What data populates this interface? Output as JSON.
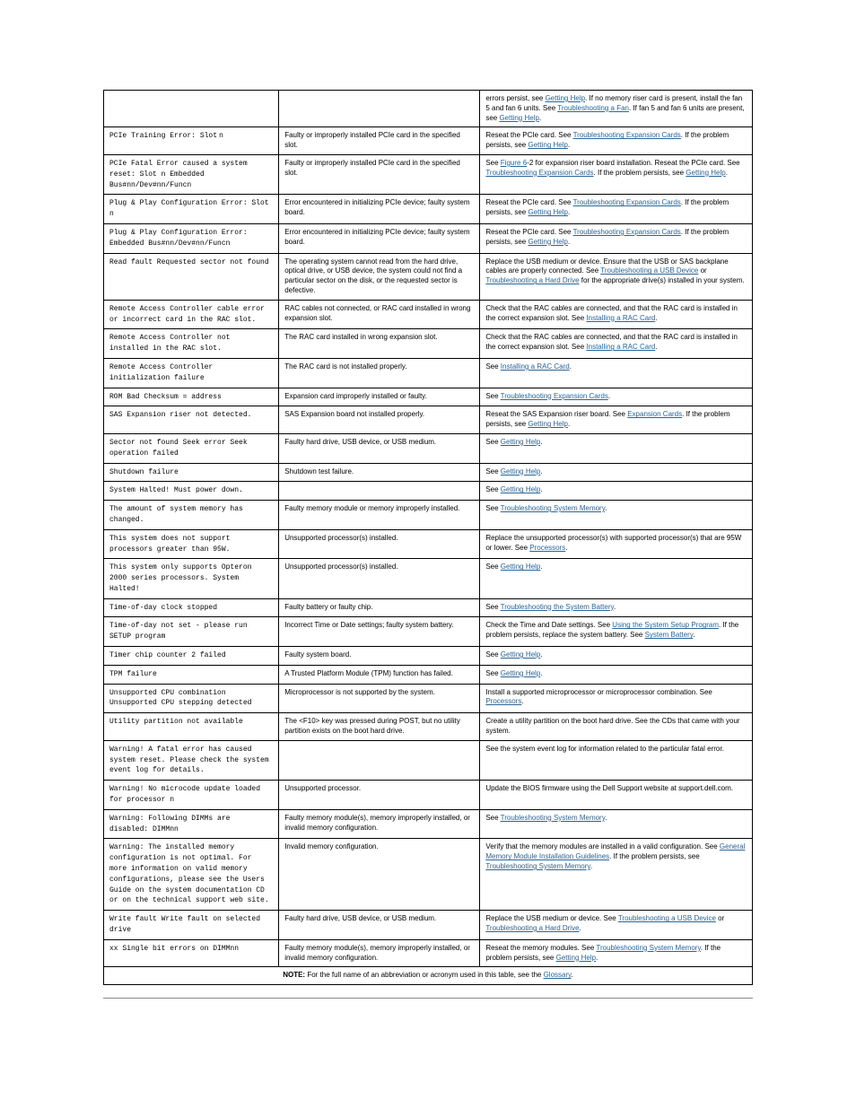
{
  "rows": [
    {
      "msg": "",
      "cause": "",
      "action_parts": [
        {
          "t": "plain",
          "v": "errors persist, see "
        },
        {
          "t": "link",
          "v": "Getting Help"
        },
        {
          "t": "plain",
          "v": ". If no memory riser card is present, install the fan 5 and fan 6 units. See "
        },
        {
          "t": "link",
          "v": "Troubleshooting a Fan"
        },
        {
          "t": "plain",
          "v": ". If fan 5 and fan 6 units are present, see "
        },
        {
          "t": "link",
          "v": "Getting Help"
        },
        {
          "t": "plain",
          "v": "."
        }
      ]
    },
    {
      "msg_mono": "PCIe Training Error: Slot",
      "msg_sans": " n",
      "cause": "Faulty or improperly installed PCIe card in the specified slot.",
      "action_parts": [
        {
          "t": "plain",
          "v": "Reseat the PCIe card. See "
        },
        {
          "t": "link",
          "v": "Troubleshooting Expansion Cards"
        },
        {
          "t": "plain",
          "v": ". If the problem persists, see "
        },
        {
          "t": "link",
          "v": "Getting Help"
        },
        {
          "t": "plain",
          "v": "."
        }
      ]
    },
    {
      "msg": "PCIe Fatal Error caused a system reset: Slot n\nEmbedded Bus#nn/Dev#nn/Funcn",
      "cause": "Faulty or improperly installed PCIe card in the specified slot.",
      "action_parts": [
        {
          "t": "plain",
          "v": "See "
        },
        {
          "t": "link",
          "v": "Figure 6"
        },
        {
          "t": "plain",
          "v": "-2 for expansion riser board installation. Reseat the PCIe card. See "
        },
        {
          "t": "link",
          "v": "Troubleshooting Expansion Cards"
        },
        {
          "t": "plain",
          "v": ". If the problem persists, see "
        },
        {
          "t": "link",
          "v": "Getting Help"
        },
        {
          "t": "plain",
          "v": "."
        }
      ]
    },
    {
      "msg": "Plug & Play Configuration Error: Slot n",
      "cause": "Error encountered in initializing PCIe device; faulty system board.",
      "action_parts": [
        {
          "t": "plain",
          "v": "Reseat the PCIe card. See "
        },
        {
          "t": "link",
          "v": "Troubleshooting Expansion Cards"
        },
        {
          "t": "plain",
          "v": ". If the problem persists, see "
        },
        {
          "t": "link",
          "v": "Getting Help"
        },
        {
          "t": "plain",
          "v": "."
        }
      ]
    },
    {
      "msg": "Plug & Play Configuration Error: Embedded Bus#nn/Dev#nn/Funcn",
      "cause": "Error encountered in initializing PCIe device; faulty system board.",
      "action_parts": [
        {
          "t": "plain",
          "v": "Reseat the PCIe card. See "
        },
        {
          "t": "link",
          "v": "Troubleshooting Expansion Cards"
        },
        {
          "t": "plain",
          "v": ". If the problem persists, see "
        },
        {
          "t": "link",
          "v": "Getting Help"
        },
        {
          "t": "plain",
          "v": "."
        }
      ]
    },
    {
      "msg": "Read fault Requested sector not found",
      "cause": "The operating system cannot read from the hard drive, optical drive, or USB device, the system could not find a particular sector on the disk, or the requested sector is defective.",
      "action_parts": [
        {
          "t": "plain",
          "v": "Replace the USB medium or device. Ensure that the USB or SAS backplane cables are properly connected. See "
        },
        {
          "t": "link",
          "v": "Troubleshooting a USB Device"
        },
        {
          "t": "plain",
          "v": " or "
        },
        {
          "t": "link",
          "v": "Troubleshooting a Hard Drive"
        },
        {
          "t": "plain",
          "v": " for the appropriate drive(s) installed in your system."
        }
      ]
    },
    {
      "msg": "Remote Access Controller cable error or incorrect card in the RAC slot.",
      "cause": "RAC cables not connected, or RAC card installed in wrong expansion slot.",
      "action_parts": [
        {
          "t": "plain",
          "v": "Check that the RAC cables are connected, and that the RAC card is installed in the correct expansion slot. See "
        },
        {
          "t": "link",
          "v": "Installing a RAC Card"
        },
        {
          "t": "plain",
          "v": "."
        }
      ]
    },
    {
      "msg": "Remote Access Controller not installed in the RAC slot.",
      "cause": "The RAC card installed in wrong expansion slot.",
      "action_parts": [
        {
          "t": "plain",
          "v": "Check that the RAC cables are connected, and that the RAC card is installed in the correct expansion slot. See "
        },
        {
          "t": "link",
          "v": "Installing a RAC Card"
        },
        {
          "t": "plain",
          "v": "."
        }
      ]
    },
    {
      "msg": "Remote Access Controller initialization failure",
      "cause": "The RAC card is not installed properly.",
      "action_parts": [
        {
          "t": "plain",
          "v": "See "
        },
        {
          "t": "link",
          "v": "Installing a RAC Card"
        },
        {
          "t": "plain",
          "v": "."
        }
      ]
    },
    {
      "msg": "ROM Bad Checksum = address",
      "cause": "Expansion card improperly installed or faulty.",
      "action_parts": [
        {
          "t": "plain",
          "v": "See "
        },
        {
          "t": "link",
          "v": "Troubleshooting Expansion Cards"
        },
        {
          "t": "plain",
          "v": "."
        }
      ]
    },
    {
      "msg": "SAS Expansion riser not detected.",
      "cause": "SAS Expansion board not installed properly.",
      "action_parts": [
        {
          "t": "plain",
          "v": "Reseat the SAS Expansion riser board. See "
        },
        {
          "t": "link",
          "v": "Expansion Cards"
        },
        {
          "t": "plain",
          "v": ". If the problem persists, see "
        },
        {
          "t": "link",
          "v": "Getting Help"
        },
        {
          "t": "plain",
          "v": "."
        }
      ]
    },
    {
      "msg": "Sector not found Seek error Seek operation failed",
      "cause": "Faulty hard drive, USB device, or USB medium.",
      "action_parts": [
        {
          "t": "plain",
          "v": "See "
        },
        {
          "t": "link",
          "v": "Getting Help"
        },
        {
          "t": "plain",
          "v": "."
        }
      ]
    },
    {
      "msg": "Shutdown failure",
      "cause": "Shutdown test failure.",
      "action_parts": [
        {
          "t": "plain",
          "v": "See "
        },
        {
          "t": "link",
          "v": "Getting Help"
        },
        {
          "t": "plain",
          "v": "."
        }
      ]
    },
    {
      "msg": "System Halted! Must power down.",
      "cause": "",
      "action_parts": [
        {
          "t": "plain",
          "v": "See "
        },
        {
          "t": "link",
          "v": "Getting Help"
        },
        {
          "t": "plain",
          "v": "."
        }
      ]
    },
    {
      "msg": "The amount of system memory has changed.",
      "cause": "Faulty memory module or memory improperly installed.",
      "action_parts": [
        {
          "t": "plain",
          "v": "See "
        },
        {
          "t": "link",
          "v": "Troubleshooting System Memory"
        },
        {
          "t": "plain",
          "v": "."
        }
      ]
    },
    {
      "msg": "This system does not support processors greater than 95W.",
      "cause": "Unsupported processor(s) installed.",
      "action_parts": [
        {
          "t": "plain",
          "v": "Replace the unsupported processor(s) with supported processor(s) that are 95W or lower. See "
        },
        {
          "t": "link",
          "v": "Processors"
        },
        {
          "t": "plain",
          "v": "."
        }
      ]
    },
    {
      "msg": "This system only supports Opteron 2000 series processors. System Halted!",
      "cause": "Unsupported processor(s) installed.",
      "action_parts": [
        {
          "t": "plain",
          "v": "See "
        },
        {
          "t": "link",
          "v": "Getting Help"
        },
        {
          "t": "plain",
          "v": "."
        }
      ]
    },
    {
      "msg": "Time-of-day clock stopped",
      "cause": "Faulty battery or faulty chip.",
      "action_parts": [
        {
          "t": "plain",
          "v": "See "
        },
        {
          "t": "link",
          "v": "Troubleshooting the System Battery"
        },
        {
          "t": "plain",
          "v": "."
        }
      ]
    },
    {
      "msg": "Time-of-day not set - please run SETUP program",
      "cause": "Incorrect Time or Date settings; faulty system battery.",
      "action_parts": [
        {
          "t": "plain",
          "v": "Check the Time and Date settings. See "
        },
        {
          "t": "link",
          "v": "Using the System Setup Program"
        },
        {
          "t": "plain",
          "v": ". If the problem persists, replace the system battery. See "
        },
        {
          "t": "link",
          "v": "System Battery"
        },
        {
          "t": "plain",
          "v": "."
        }
      ]
    },
    {
      "msg": "Timer chip counter 2 failed",
      "cause": "Faulty system board.",
      "action_parts": [
        {
          "t": "plain",
          "v": "See "
        },
        {
          "t": "link",
          "v": "Getting Help"
        },
        {
          "t": "plain",
          "v": "."
        }
      ]
    },
    {
      "msg": "TPM failure",
      "cause": "A Trusted Platform Module (TPM) function has failed.",
      "action_parts": [
        {
          "t": "plain",
          "v": "See "
        },
        {
          "t": "link",
          "v": "Getting Help"
        },
        {
          "t": "plain",
          "v": "."
        }
      ]
    },
    {
      "msg": "Unsupported CPU combination Unsupported CPU stepping detected",
      "cause": "Microprocessor is not supported by the system.",
      "action_parts": [
        {
          "t": "plain",
          "v": "Install a supported microprocessor or microprocessor combination. See "
        },
        {
          "t": "link",
          "v": "Processors"
        },
        {
          "t": "plain",
          "v": "."
        }
      ]
    },
    {
      "msg": "Utility partition not available",
      "cause": "The <F10> key was pressed during POST, but no utility partition exists on the boot hard drive.",
      "action_parts": [
        {
          "t": "plain",
          "v": "Create a utility partition on the boot hard drive. See the CDs that came with your system."
        }
      ]
    },
    {
      "msg": "Warning! A fatal error has caused system reset. Please check the system event log for details.",
      "cause": "",
      "action_parts": [
        {
          "t": "plain",
          "v": "See the system event log for information related to the particular fatal error."
        }
      ]
    },
    {
      "msg": "Warning! No microcode update loaded for processor n",
      "cause": "Unsupported processor.",
      "action_parts": [
        {
          "t": "plain",
          "v": "Update the BIOS firmware using the Dell Support website at support.dell.com."
        }
      ]
    },
    {
      "msg": "Warning: Following DIMMs are disabled: DIMMnn",
      "cause": "Faulty memory module(s), memory improperly installed, or invalid memory configuration.",
      "action_parts": [
        {
          "t": "plain",
          "v": "See "
        },
        {
          "t": "link",
          "v": "Troubleshooting System Memory"
        },
        {
          "t": "plain",
          "v": "."
        }
      ]
    },
    {
      "msg": "Warning: The installed memory configuration is not optimal. For more information on valid memory configurations, please see the Users Guide on the system documentation CD or on the technical support web site.",
      "cause": "Invalid memory configuration.",
      "action_parts": [
        {
          "t": "plain",
          "v": "Verify that the memory modules are installed in a valid configuration. See "
        },
        {
          "t": "link",
          "v": "General Memory Module Installation Guidelines"
        },
        {
          "t": "plain",
          "v": ". If the problem persists, see "
        },
        {
          "t": "link",
          "v": "Troubleshooting System Memory"
        },
        {
          "t": "plain",
          "v": "."
        }
      ]
    },
    {
      "msg": "Write fault Write fault on selected drive",
      "cause": "Faulty hard drive, USB device, or USB medium.",
      "action_parts": [
        {
          "t": "plain",
          "v": "Replace the USB medium or device. See "
        },
        {
          "t": "link",
          "v": "Troubleshooting a USB Device"
        },
        {
          "t": "plain",
          "v": " or "
        },
        {
          "t": "link",
          "v": "Troubleshooting a Hard Drive"
        },
        {
          "t": "plain",
          "v": "."
        }
      ]
    },
    {
      "msg": "xx Single bit errors on DIMMnn",
      "cause": "Faulty memory module(s), memory improperly installed, or invalid memory configuration.",
      "action_parts": [
        {
          "t": "plain",
          "v": "Reseat the memory modules. See "
        },
        {
          "t": "link",
          "v": "Troubleshooting System Memory"
        },
        {
          "t": "plain",
          "v": ". If the problem persists, see "
        },
        {
          "t": "link",
          "v": "Getting Help"
        },
        {
          "t": "plain",
          "v": "."
        }
      ]
    }
  ],
  "note": {
    "label": "NOTE:",
    "text_before": " For the full name of an abbreviation or acronym used in this table, see the ",
    "link": "Glossary",
    "text_after": "."
  }
}
